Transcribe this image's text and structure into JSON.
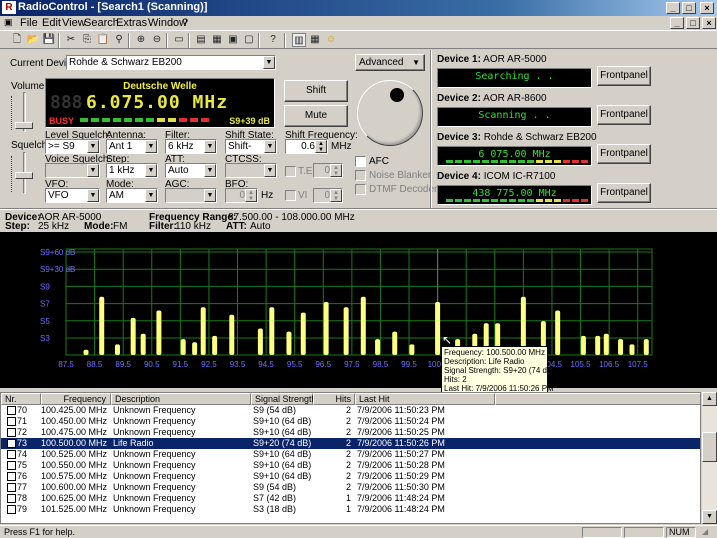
{
  "window": {
    "title": "RadioControl - [Search1 (Scanning)]",
    "app_icon": "R"
  },
  "menu": [
    "File",
    "Edit",
    "View",
    "Search",
    "Extras",
    "Window",
    "?"
  ],
  "current_device": {
    "label": "Current Device:",
    "value": "Rohde & Schwarz EB200"
  },
  "advanced_button": "Advanced",
  "volume_label": "Volume",
  "squelch_label": "Squelch",
  "display": {
    "station": "Deutsche Welle",
    "ghost_digits": "888",
    "frequency": "6.075.00 MHz",
    "busy": "BUSY",
    "signal": "S9+39 dB"
  },
  "shift_button": "Shift",
  "mute_button": "Mute",
  "controls": {
    "level_squelch": {
      "label": "Level Squelch:",
      "value": ">= S9"
    },
    "antenna": {
      "label": "Antenna:",
      "value": "Ant 1"
    },
    "filter": {
      "label": "Filter:",
      "value": "6 kHz"
    },
    "shift_state": {
      "label": "Shift State:",
      "value": "Shift-"
    },
    "shift_frequency": {
      "label": "Shift Frequency:",
      "value": "0.6",
      "unit": "MHz"
    },
    "voice_squelch": {
      "label": "Voice Squelch:",
      "value": ""
    },
    "step": {
      "label": "Step:",
      "value": "1 kHz"
    },
    "att": {
      "label": "ATT:",
      "value": "Auto"
    },
    "ctcss": {
      "label": "CTCSS:",
      "value": ""
    },
    "te": {
      "label": "T.E.",
      "value": "0"
    },
    "vfo": {
      "label": "VFO:",
      "value": "VFO"
    },
    "mode": {
      "label": "Mode:",
      "value": "AM"
    },
    "agc": {
      "label": "AGC:",
      "value": ""
    },
    "bfo": {
      "label": "BFO:",
      "value": "0",
      "unit": "Hz"
    },
    "vi": {
      "label": "VI",
      "value": "0"
    }
  },
  "checkboxes": {
    "afc": "AFC",
    "noise_blanker": "Noise Blanker",
    "dtmf": "DTMF Decoder"
  },
  "devices": [
    {
      "title": "Device 1:",
      "name": "AOR AR-5000",
      "screen": "Searching . .",
      "color": "#30e030",
      "button": "Frontpanel"
    },
    {
      "title": "Device 2:",
      "name": "AOR AR-8600",
      "screen": "Scanning . .",
      "color": "#30e030",
      "button": "Frontpanel"
    },
    {
      "title": "Device 3:",
      "name": "Rohde & Schwarz EB200",
      "screen": "6 075.00 MHz",
      "color": "#30e030",
      "button": "Frontpanel"
    },
    {
      "title": "Device 4:",
      "name": "ICOM IC-R7100",
      "screen": "438 775.00 MHz",
      "color": "#30e030",
      "button": "Frontpanel"
    }
  ],
  "info": {
    "device_label": "Device:",
    "device_value": "AOR AR-5000",
    "step_label": "Step:",
    "step_value": "25 kHz",
    "mode_label": "Mode:",
    "mode_value": "FM",
    "range_label": "Frequency Range:",
    "range_value": "87.500.00 - 108.000.00 MHz",
    "filter_label": "Filter:",
    "filter_value": "110 kHz",
    "att_label": "ATT:",
    "att_value": "Auto"
  },
  "chart_data": {
    "type": "bar",
    "x_ticks": [
      "87.5",
      "88.5",
      "89.5",
      "90.5",
      "91.5",
      "92.5",
      "93.5",
      "94.5",
      "95.5",
      "96.5",
      "97.5",
      "98.5",
      "99.5",
      "100.5",
      "101.5",
      "102.5",
      "103.5",
      "104.5",
      "105.5",
      "106.5",
      "107.5"
    ],
    "y_ticks": [
      "S9+60 dB",
      "S9+30 dB",
      "S9",
      "S7",
      "S5",
      "S3"
    ],
    "xlim": [
      87.5,
      108.0
    ],
    "ylim_labels": [
      "S3",
      "S9+60 dB"
    ],
    "bar_color": "#ffff80",
    "grid": true,
    "marker_frequency": 100.5,
    "bars": [
      {
        "x": 88.2,
        "level": 0.05
      },
      {
        "x": 88.75,
        "level": 0.55
      },
      {
        "x": 89.3,
        "level": 0.1
      },
      {
        "x": 89.85,
        "level": 0.35
      },
      {
        "x": 90.2,
        "level": 0.2
      },
      {
        "x": 90.75,
        "level": 0.42
      },
      {
        "x": 91.6,
        "level": 0.15
      },
      {
        "x": 92.0,
        "level": 0.12
      },
      {
        "x": 92.3,
        "level": 0.45
      },
      {
        "x": 92.7,
        "level": 0.18
      },
      {
        "x": 93.3,
        "level": 0.38
      },
      {
        "x": 94.3,
        "level": 0.25
      },
      {
        "x": 94.7,
        "level": 0.45
      },
      {
        "x": 95.3,
        "level": 0.22
      },
      {
        "x": 95.8,
        "level": 0.4
      },
      {
        "x": 96.6,
        "level": 0.5
      },
      {
        "x": 97.3,
        "level": 0.45
      },
      {
        "x": 97.9,
        "level": 0.55
      },
      {
        "x": 98.4,
        "level": 0.15
      },
      {
        "x": 99.0,
        "level": 0.22
      },
      {
        "x": 99.6,
        "level": 0.1
      },
      {
        "x": 100.5,
        "level": 0.5
      },
      {
        "x": 101.2,
        "level": 0.15
      },
      {
        "x": 101.8,
        "level": 0.2
      },
      {
        "x": 102.2,
        "level": 0.3
      },
      {
        "x": 102.6,
        "level": 0.3
      },
      {
        "x": 103.5,
        "level": 0.55
      },
      {
        "x": 104.2,
        "level": 0.32
      },
      {
        "x": 104.7,
        "level": 0.42
      },
      {
        "x": 105.6,
        "level": 0.18
      },
      {
        "x": 106.1,
        "level": 0.18
      },
      {
        "x": 106.4,
        "level": 0.2
      },
      {
        "x": 106.9,
        "level": 0.15
      },
      {
        "x": 107.3,
        "level": 0.1
      },
      {
        "x": 107.8,
        "level": 0.15
      }
    ]
  },
  "tooltip": {
    "frequency": "Frequency: 100.500.00 MHz",
    "description": "Description: Life Radio",
    "signal": "Signal Strength: S9+20 (74 dB)",
    "hits": "Hits: 2",
    "last_hit": "Last Hit: 7/9/2006 11:50:26 PM"
  },
  "table": {
    "headers": [
      "Nr.",
      "Frequency",
      "Description",
      "Signal Strength",
      "Hits",
      "Last Hit"
    ],
    "rows": [
      [
        "70",
        "100.425.00 MHz",
        "Unknown Frequency",
        "S9 (54 dB)",
        "2",
        "7/9/2006 11:50:23 PM"
      ],
      [
        "71",
        "100.450.00 MHz",
        "Unknown Frequency",
        "S9+10 (64 dB)",
        "2",
        "7/9/2006 11:50:24 PM"
      ],
      [
        "72",
        "100.475.00 MHz",
        "Unknown Frequency",
        "S9+10 (64 dB)",
        "2",
        "7/9/2006 11:50:25 PM"
      ],
      [
        "73",
        "100.500.00 MHz",
        "Life Radio",
        "S9+20 (74 dB)",
        "2",
        "7/9/2006 11:50:26 PM"
      ],
      [
        "74",
        "100.525.00 MHz",
        "Unknown Frequency",
        "S9+10 (64 dB)",
        "2",
        "7/9/2006 11:50:27 PM"
      ],
      [
        "75",
        "100.550.00 MHz",
        "Unknown Frequency",
        "S9+10 (64 dB)",
        "2",
        "7/9/2006 11:50:28 PM"
      ],
      [
        "76",
        "100.575.00 MHz",
        "Unknown Frequency",
        "S9+10 (64 dB)",
        "2",
        "7/9/2006 11:50:29 PM"
      ],
      [
        "77",
        "100.600.00 MHz",
        "Unknown Frequency",
        "S9 (54 dB)",
        "2",
        "7/9/2006 11:50:30 PM"
      ],
      [
        "78",
        "100.625.00 MHz",
        "Unknown Frequency",
        "S7 (42 dB)",
        "1",
        "7/9/2006 11:48:24 PM"
      ],
      [
        "79",
        "101.525.00 MHz",
        "Unknown Frequency",
        "S3 (18 dB)",
        "1",
        "7/9/2006 11:48:24 PM"
      ]
    ],
    "selected_index": 3
  },
  "status": {
    "help": "Press F1 for help.",
    "num": "NUM"
  }
}
